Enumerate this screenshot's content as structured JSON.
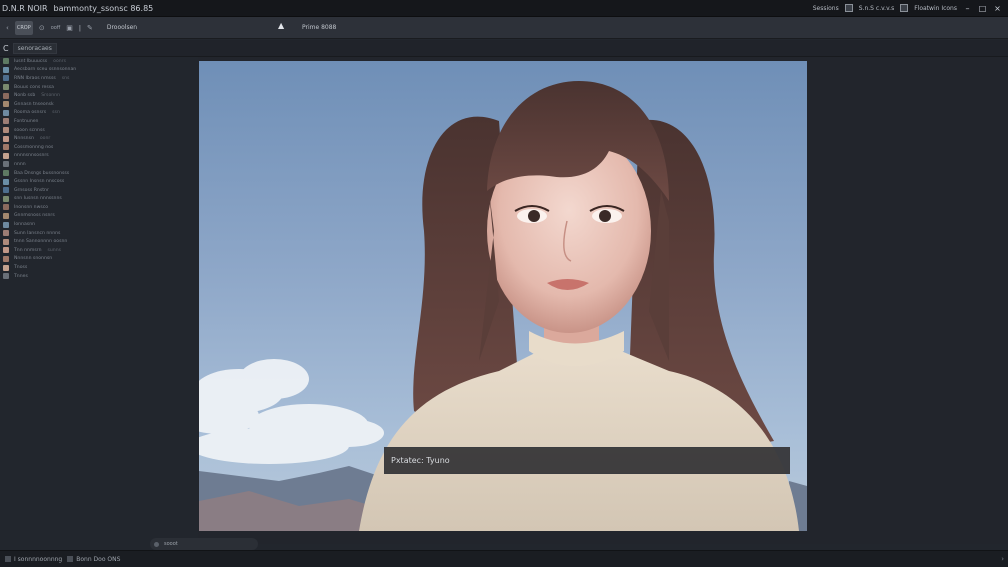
{
  "titlebar": {
    "app_name": "D.N.R NOIR",
    "document_title": "bammonty_ssonsc 86.85",
    "right_items": [
      "Sessions",
      "S.n.S c.v.v.s",
      "Floatwin Icons"
    ],
    "controls": [
      "–",
      "□",
      "×"
    ]
  },
  "toolbar": {
    "tools": [
      {
        "icon": "arrow-icon",
        "label": "‹"
      },
      {
        "icon": "crop-icon",
        "label": "CROP"
      },
      {
        "icon": "lasso-icon",
        "label": "⊙"
      },
      {
        "icon": "clone-icon",
        "label": "ooff"
      },
      {
        "icon": "stamp-icon",
        "label": "▣"
      },
      {
        "icon": "divider-icon",
        "label": "ǀ"
      },
      {
        "icon": "brush-icon",
        "label": "✎"
      }
    ],
    "label": "Drooolsen",
    "triangle": "▲",
    "zoom": "Prime 8088"
  },
  "subbar": {
    "refresh": "C",
    "search": "senoracaes"
  },
  "sidebar": {
    "files": [
      {
        "name": "Iusnt Ibuuucss",
        "meta": "oonrs"
      },
      {
        "name": "Aecsbarn sceu ssnnsonnan",
        "meta": ""
      },
      {
        "name": "RNN Ibraos nmsss",
        "meta": "sns"
      },
      {
        "name": "Bouus  cons ressa",
        "meta": ""
      },
      {
        "name": "Nonb ssb",
        "meta": "Srsonnn"
      },
      {
        "name": "Gnnasn tnseonsk",
        "meta": ""
      },
      {
        "name": "Rooma  osnsrs",
        "meta": "ssn"
      },
      {
        "name": "Fontnunen",
        "meta": ""
      },
      {
        "name": "sooon scnnss",
        "meta": ""
      },
      {
        "name": "Nnnsnsn",
        "meta": "oonr"
      },
      {
        "name": "Cossmonnng nos",
        "meta": ""
      },
      {
        "name": "nnnnsnnsosnrs",
        "meta": ""
      },
      {
        "name": "nnnn",
        "meta": ""
      },
      {
        "name": "Baa  Dnsngs  bussnonsss",
        "meta": ""
      },
      {
        "name": "Gssnn  Insnsn nnscoss",
        "meta": ""
      },
      {
        "name": "Grnsoss Rnstnr",
        "meta": ""
      },
      {
        "name": "snn Iusnsn nnnssnns",
        "meta": ""
      },
      {
        "name": "Inonsnn nwsco",
        "meta": ""
      },
      {
        "name": "Gnnmsnoss nsnrs",
        "meta": ""
      },
      {
        "name": "Ionnasnn",
        "meta": ""
      },
      {
        "name": "Sunn Iansncn nnnns",
        "meta": ""
      },
      {
        "name": "tnnn Sannonnnn oosnn",
        "meta": ""
      },
      {
        "name": "Tnn nnmsrn",
        "meta": "sunns"
      },
      {
        "name": "Nnnsnn  snonnsn",
        "meta": ""
      },
      {
        "name": "Tnoss",
        "meta": ""
      },
      {
        "name": "Tnnes",
        "meta": ""
      }
    ]
  },
  "canvas": {
    "caption": "Pxtatec: Tyuno"
  },
  "dockbar": {
    "label": "sooot"
  },
  "statusbar": {
    "items": [
      "I sonnnnoonnng",
      "Bonn  Doo  ONS"
    ],
    "right": "›"
  }
}
